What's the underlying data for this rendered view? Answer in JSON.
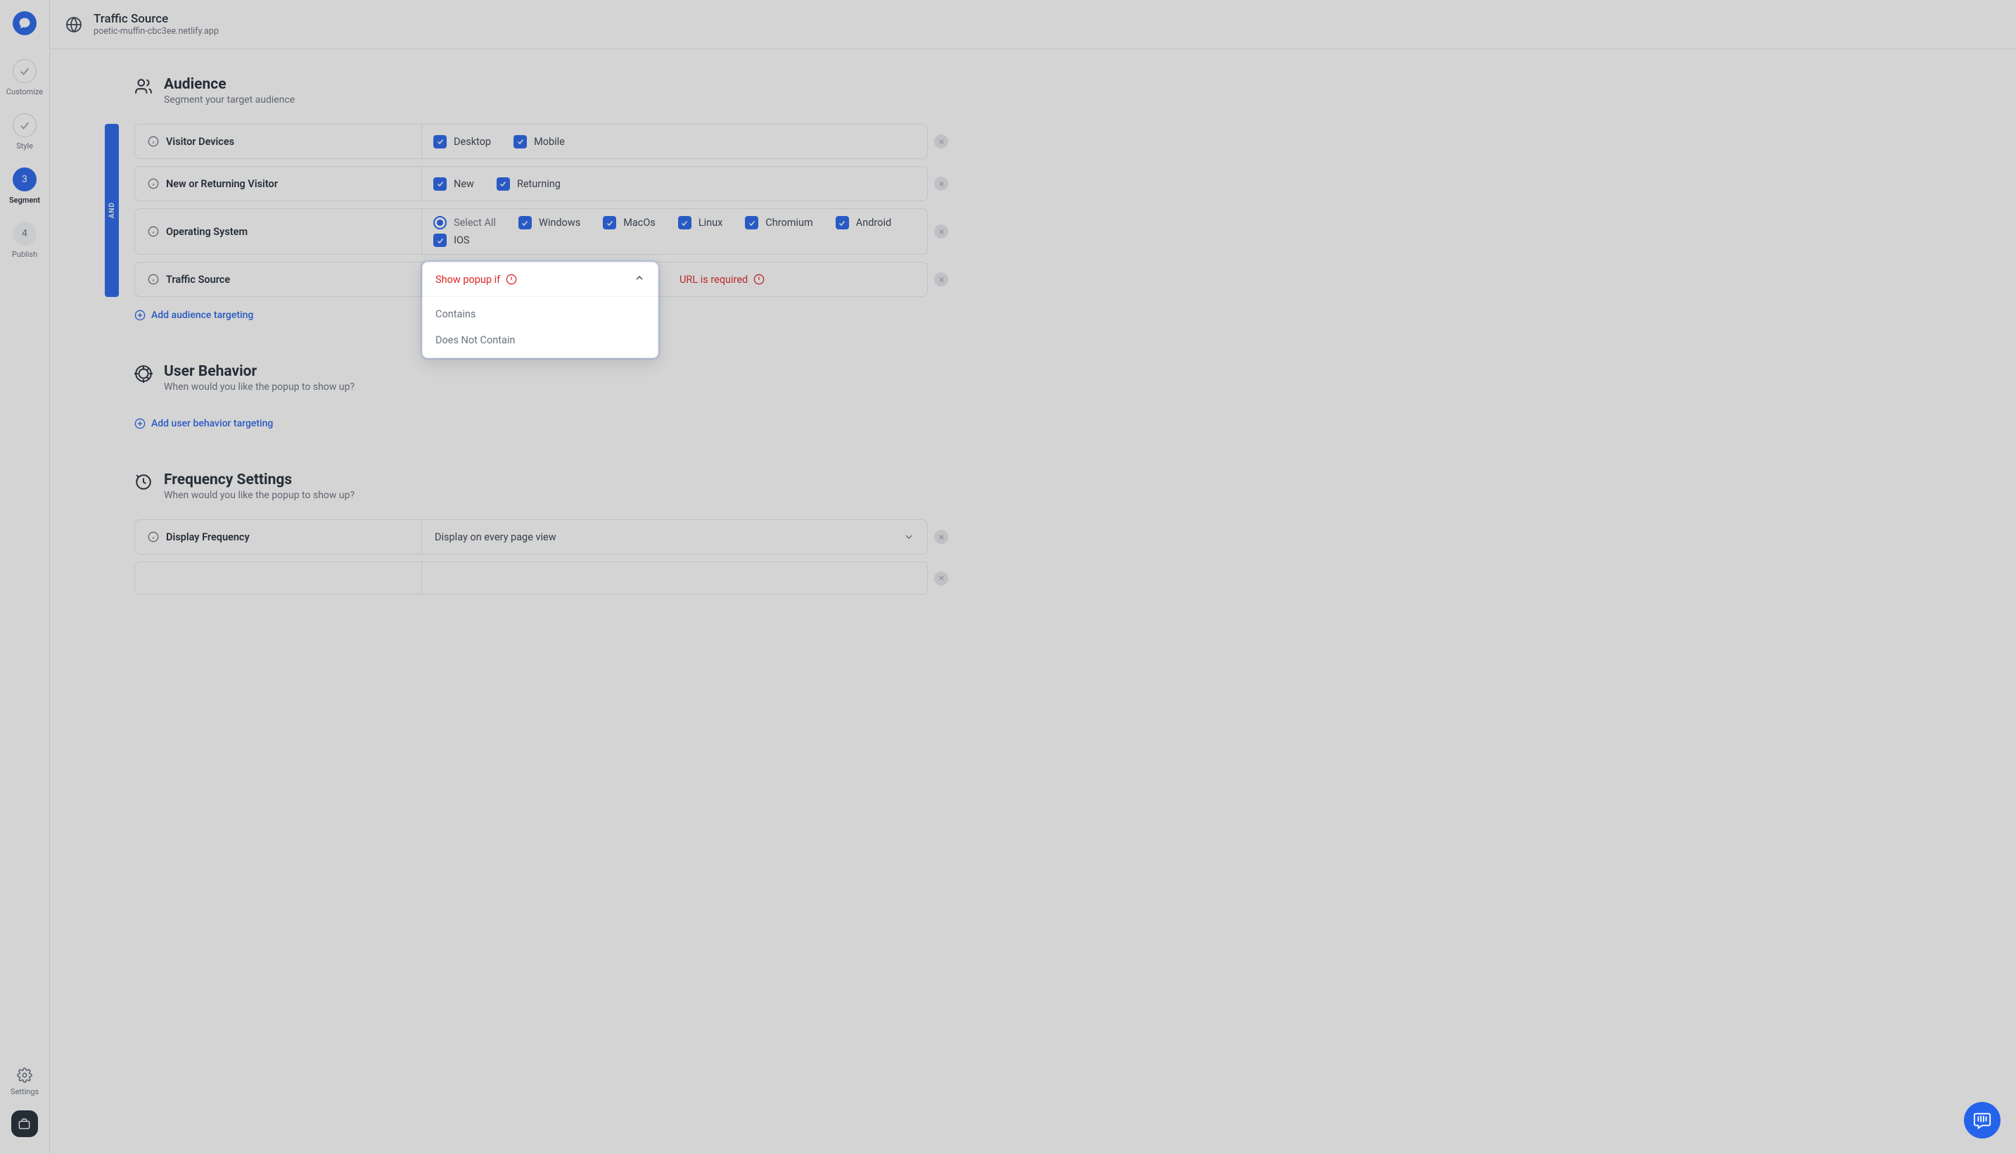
{
  "header": {
    "title": "Traffic Source",
    "subtitle": "poetic-muffin-cbc3ee.netlify.app"
  },
  "sidebar": {
    "steps": [
      {
        "label": "Customize"
      },
      {
        "label": "Style"
      },
      {
        "num": "3",
        "label": "Segment"
      },
      {
        "num": "4",
        "label": "Publish"
      }
    ],
    "settings_label": "Settings"
  },
  "audience": {
    "title": "Audience",
    "subtitle": "Segment your target audience",
    "and_label": "AND",
    "rules": {
      "visitor_devices": {
        "label": "Visitor Devices",
        "opts": {
          "desktop": "Desktop",
          "mobile": "Mobile"
        }
      },
      "new_returning": {
        "label": "New or Returning Visitor",
        "opts": {
          "new": "New",
          "returning": "Returning"
        }
      },
      "os": {
        "label": "Operating System",
        "opts": {
          "select_all": "Select All",
          "windows": "Windows",
          "macos": "MacOs",
          "linux": "Linux",
          "chromium": "Chromium",
          "android": "Android",
          "ios": "IOS"
        }
      },
      "traffic_source": {
        "label": "Traffic Source",
        "dropdown_title": "Show popup if",
        "opt_contains": "Contains",
        "opt_not_contains": "Does Not Contain",
        "url_error": "URL is required"
      }
    },
    "add_btn": "Add audience targeting"
  },
  "behavior": {
    "title": "User Behavior",
    "subtitle": "When would you like the popup to show up?",
    "add_btn": "Add user behavior targeting"
  },
  "frequency": {
    "title": "Frequency Settings",
    "subtitle": "When would you like the popup to show up?",
    "display_frequency": {
      "label": "Display Frequency",
      "value": "Display on every page view"
    }
  }
}
